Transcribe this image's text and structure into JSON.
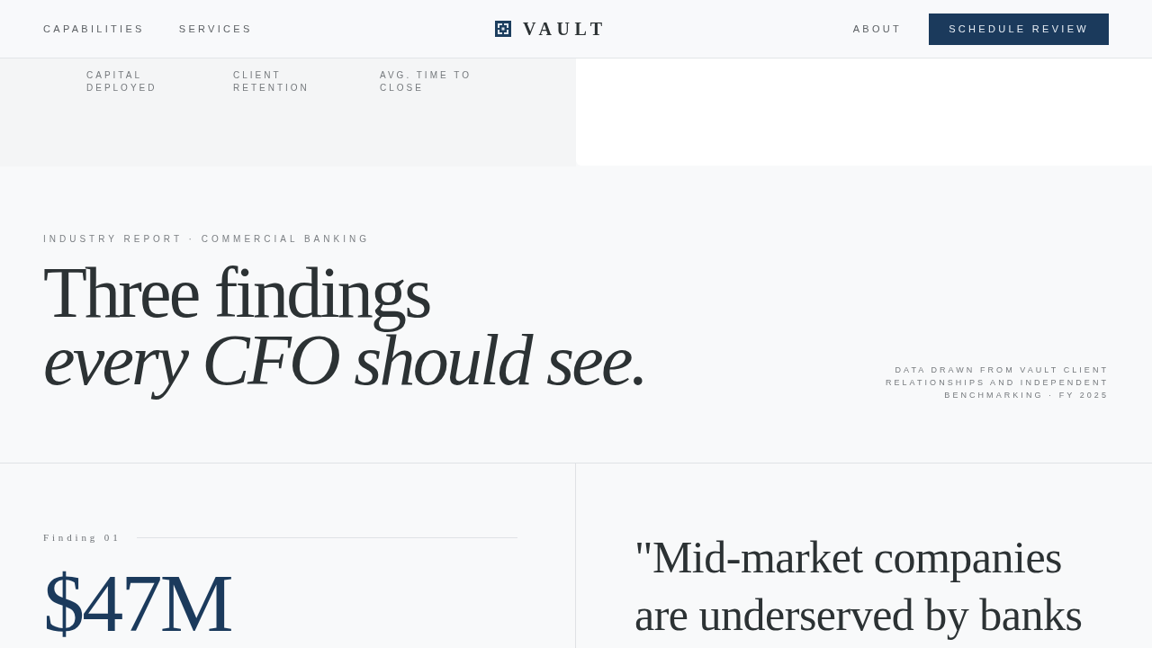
{
  "header": {
    "nav_left": [
      "CAPABILITIES",
      "SERVICES"
    ],
    "brand": "VAULT",
    "nav_right": [
      "ABOUT"
    ],
    "cta": "SCHEDULE REVIEW"
  },
  "hero": {
    "stats": [
      {
        "label": "CAPITAL DEPLOYED"
      },
      {
        "label": "CLIENT RETENTION"
      },
      {
        "label": "AVG. TIME TO CLOSE"
      }
    ]
  },
  "report": {
    "eyebrow": "INDUSTRY REPORT · COMMERCIAL BANKING",
    "headline": "Three findings",
    "headline_italic": "every CFO should see.",
    "source_note": "DATA DRAWN FROM VAULT CLIENT RELATIONSHIPS AND INDEPENDENT BENCHMARKING · FY 2025"
  },
  "finding": {
    "label": "Finding 01",
    "figure": "$47M",
    "quote": "\"Mid-market companies are underserved by banks"
  }
}
